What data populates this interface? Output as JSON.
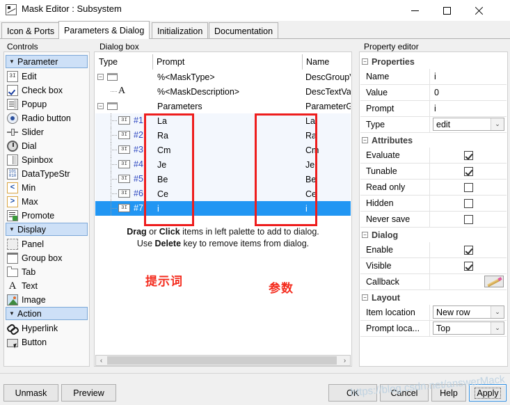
{
  "window": {
    "title": "Mask Editor : Subsystem",
    "icon": "mask-editor-icon",
    "minimize": "minimize-icon",
    "maximize": "maximize-icon",
    "close": "close-icon"
  },
  "tabs": [
    {
      "label": "Icon & Ports",
      "active": false
    },
    {
      "label": "Parameters & Dialog",
      "active": true
    },
    {
      "label": "Initialization",
      "active": false
    },
    {
      "label": "Documentation",
      "active": false
    }
  ],
  "controls": {
    "group_label": "Controls",
    "sections": [
      {
        "header": "Parameter",
        "caret": "▼",
        "items": [
          {
            "label": "Edit",
            "icon": "edit-icon",
            "glyph": "3I"
          },
          {
            "label": "Check box",
            "icon": "checkbox-icon",
            "glyph": ""
          },
          {
            "label": "Popup",
            "icon": "popup-icon",
            "glyph": ""
          },
          {
            "label": "Radio button",
            "icon": "radio-button-icon",
            "glyph": ""
          },
          {
            "label": "Slider",
            "icon": "slider-icon",
            "glyph": ""
          },
          {
            "label": "Dial",
            "icon": "dial-icon",
            "glyph": ""
          },
          {
            "label": "Spinbox",
            "icon": "spinbox-icon",
            "glyph": ""
          },
          {
            "label": "DataTypeStr",
            "icon": "datatypestr-icon",
            "glyph": "101 010"
          },
          {
            "label": "Min",
            "icon": "min-icon",
            "glyph": "<"
          },
          {
            "label": "Max",
            "icon": "max-icon",
            "glyph": ">"
          },
          {
            "label": "Promote",
            "icon": "promote-icon",
            "glyph": ""
          }
        ]
      },
      {
        "header": "Display",
        "caret": "▼",
        "items": [
          {
            "label": "Panel",
            "icon": "panel-icon",
            "glyph": ""
          },
          {
            "label": "Group box",
            "icon": "group-box-icon",
            "glyph": ""
          },
          {
            "label": "Tab",
            "icon": "tab-icon",
            "glyph": ""
          },
          {
            "label": "Text",
            "icon": "text-icon",
            "glyph": "A"
          },
          {
            "label": "Image",
            "icon": "image-icon",
            "glyph": ""
          }
        ]
      },
      {
        "header": "Action",
        "caret": "▼",
        "items": [
          {
            "label": "Hyperlink",
            "icon": "hyperlink-icon",
            "glyph": ""
          },
          {
            "label": "Button",
            "icon": "button-icon",
            "glyph": ""
          }
        ]
      }
    ]
  },
  "dialog_box": {
    "group_label": "Dialog box",
    "columns": [
      "Type",
      "Prompt",
      "Name"
    ],
    "rows": [
      {
        "kind": "group",
        "indent": 0,
        "number": "",
        "prompt": "%<MaskType>",
        "name": "DescGroupVar",
        "selected": false
      },
      {
        "kind": "text",
        "indent": 1,
        "number": "",
        "prompt": "%<MaskDescription>",
        "name": "DescTextVar",
        "selected": false
      },
      {
        "kind": "group",
        "indent": 0,
        "number": "",
        "prompt": "Parameters",
        "name": "ParameterGroupVar",
        "selected": false
      },
      {
        "kind": "edit",
        "indent": 1,
        "number": "#1",
        "prompt": "La",
        "name": "La",
        "selected": false
      },
      {
        "kind": "edit",
        "indent": 1,
        "number": "#2",
        "prompt": "Ra",
        "name": "Ra",
        "selected": false
      },
      {
        "kind": "edit",
        "indent": 1,
        "number": "#3",
        "prompt": "Cm",
        "name": "Cm",
        "selected": false
      },
      {
        "kind": "edit",
        "indent": 1,
        "number": "#4",
        "prompt": "Je",
        "name": "Je",
        "selected": false
      },
      {
        "kind": "edit",
        "indent": 1,
        "number": "#5",
        "prompt": "Be",
        "name": "Be",
        "selected": false
      },
      {
        "kind": "edit",
        "indent": 1,
        "number": "#6",
        "prompt": "Ce",
        "name": "Ce",
        "selected": false
      },
      {
        "kind": "edit",
        "indent": 1,
        "number": "#7",
        "prompt": "i",
        "name": "i",
        "selected": true
      }
    ],
    "hint_line1_a": "Drag",
    "hint_line1_b": " or ",
    "hint_line1_c": "Click",
    "hint_line1_d": " items in left palette to add to dialog.",
    "hint_line2_a": "Use ",
    "hint_line2_b": "Delete",
    "hint_line2_c": " key to remove items from dialog.",
    "scroll_left": "‹",
    "scroll_right": "›"
  },
  "annotations": {
    "prompt_note": "提示词",
    "param_note": "参数",
    "highlight_color": "#ee1d1d"
  },
  "property_editor": {
    "group_label": "Property editor",
    "sections": [
      {
        "title": "Properties",
        "rows": [
          {
            "key": "Name",
            "value": "i",
            "control": "text"
          },
          {
            "key": "Value",
            "value": "0",
            "control": "text"
          },
          {
            "key": "Prompt",
            "value": "i",
            "control": "text"
          },
          {
            "key": "Type",
            "value": "edit",
            "control": "combo"
          }
        ]
      },
      {
        "title": "Attributes",
        "rows": [
          {
            "key": "Evaluate",
            "value": "",
            "control": "checkbox",
            "checked": true
          },
          {
            "key": "Tunable",
            "value": "",
            "control": "checkbox",
            "checked": true
          },
          {
            "key": "Read only",
            "value": "",
            "control": "checkbox",
            "checked": false
          },
          {
            "key": "Hidden",
            "value": "",
            "control": "checkbox",
            "checked": false
          },
          {
            "key": "Never save",
            "value": "",
            "control": "checkbox",
            "checked": false
          }
        ]
      },
      {
        "title": "Dialog",
        "rows": [
          {
            "key": "Enable",
            "value": "",
            "control": "checkbox",
            "checked": true
          },
          {
            "key": "Visible",
            "value": "",
            "control": "checkbox",
            "checked": true
          },
          {
            "key": "Callback",
            "value": "",
            "control": "pencil"
          }
        ]
      },
      {
        "title": "Layout",
        "rows": [
          {
            "key": "Item location",
            "value": "New row",
            "control": "combo"
          },
          {
            "key": "Prompt loca...",
            "value": "Top",
            "control": "combo"
          }
        ]
      }
    ]
  },
  "footer": {
    "unmask": "Unmask",
    "preview": "Preview",
    "ok": "OK",
    "cancel": "Cancel",
    "help": "Help",
    "apply": "Apply"
  },
  "watermark": "https://blog.csdn.net/answerMack"
}
